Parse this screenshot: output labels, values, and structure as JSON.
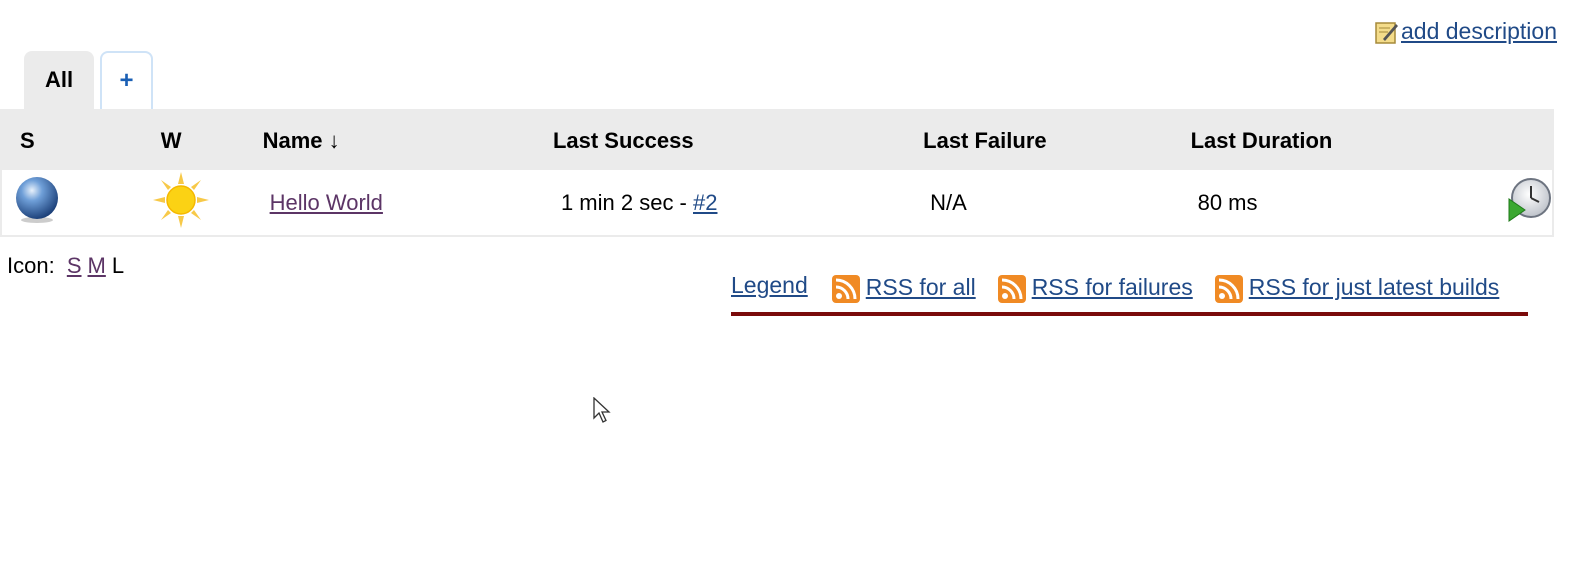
{
  "header": {
    "add_description": "add description"
  },
  "tabs": [
    {
      "label": "All"
    },
    {
      "label": "+"
    }
  ],
  "table": {
    "columns": [
      "S",
      "W",
      "Name ↓",
      "Last Success",
      "Last Failure",
      "Last Duration"
    ],
    "rows": [
      {
        "status_icon": "blue-ball-icon",
        "weather_icon": "sunny-icon",
        "name": "Hello World",
        "last_success_text": "1 min 2 sec - ",
        "last_success_build": "#2",
        "last_failure": "N/A",
        "last_duration": "80 ms",
        "action_icon": "schedule-build-icon"
      }
    ]
  },
  "icon_size": {
    "label": "Icon:",
    "options": [
      "S",
      "M",
      "L"
    ]
  },
  "footer": {
    "legend": "Legend",
    "rss_all": "RSS for all",
    "rss_failures": "RSS for failures",
    "rss_latest": "RSS for just latest builds"
  },
  "colors": {
    "link": "#204a87",
    "visited": "#5c3566",
    "header_bg": "#ebebeb",
    "footer_rule": "#7a0a0a"
  }
}
